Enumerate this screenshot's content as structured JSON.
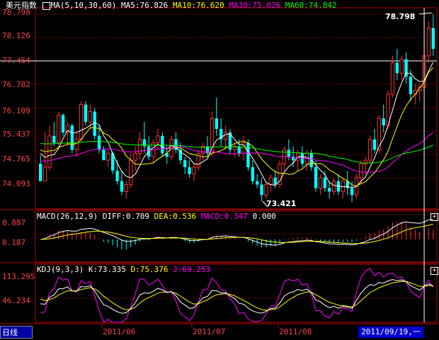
{
  "colors": {
    "up": "#ff3030",
    "down": "#00ffff",
    "ma5": "#ffffff",
    "ma10": "#ffff00",
    "ma30": "#ff00ff",
    "ma60": "#00ff00",
    "grid": "#800000",
    "axis": "#b00000"
  },
  "legend": {
    "name": "美元指数",
    "ma_params": "MA(5,10,30,60)",
    "ma5": "MA5:76.826",
    "ma10": "MA10:76.620",
    "ma30": "MA30:75.026",
    "ma60": "MA60:74.842"
  },
  "price_panel": {
    "y_ticks": [
      "78.798",
      "78.126",
      "77.454",
      "76.782",
      "76.109",
      "75.437",
      "74.765",
      "74.093"
    ],
    "high_label": "78.798",
    "low_label": "73.421"
  },
  "macd_panel": {
    "params": "MACD(26,12,9)",
    "diff": "DIFF:0.709",
    "dea": "DEA:0.536",
    "macd": "MACD:0.347",
    "zero": "0.000",
    "y_ticks": [
      "0.887",
      "0.187"
    ]
  },
  "kdj_panel": {
    "params": "KDJ(9,3,3)",
    "k": "K:73.335",
    "d": "D:75.376",
    "j": "J:69.253",
    "y_ticks": [
      "113.295",
      "46.234"
    ]
  },
  "x_axis": {
    "labels": [
      "2011/06",
      "2011/07",
      "2011/08"
    ],
    "current_date": "2011/09/19,一"
  },
  "tab": {
    "label": "日线"
  },
  "chart_data": {
    "type": "candlestick",
    "candles": [
      [
        74.5,
        74.75,
        74.0,
        74.0
      ],
      [
        74.0,
        75.4,
        74.2,
        74.4
      ],
      [
        74.4,
        75.6,
        74.3,
        75.3
      ],
      [
        75.3,
        75.7,
        75.0,
        75.1
      ],
      [
        75.1,
        76.0,
        74.9,
        75.9
      ],
      [
        75.9,
        75.95,
        75.3,
        75.4
      ],
      [
        75.4,
        75.7,
        75.0,
        75.6
      ],
      [
        75.6,
        75.65,
        74.8,
        74.9
      ],
      [
        74.9,
        75.4,
        74.7,
        75.2
      ],
      [
        75.2,
        76.3,
        75.1,
        76.2
      ],
      [
        76.2,
        76.3,
        75.6,
        75.7
      ],
      [
        75.7,
        76.2,
        75.5,
        76.0
      ],
      [
        76.0,
        76.1,
        75.2,
        75.3
      ],
      [
        75.3,
        75.6,
        74.8,
        74.9
      ],
      [
        74.9,
        75.0,
        74.6,
        74.6
      ],
      [
        74.6,
        74.9,
        74.4,
        74.8
      ],
      [
        74.8,
        74.85,
        74.2,
        74.3
      ],
      [
        74.3,
        74.6,
        73.9,
        74.0
      ],
      [
        74.0,
        74.3,
        73.6,
        73.7
      ],
      [
        73.7,
        74.0,
        73.5,
        73.9
      ],
      [
        73.9,
        74.8,
        73.8,
        74.6
      ],
      [
        74.6,
        75.0,
        74.3,
        74.8
      ],
      [
        74.8,
        75.4,
        74.6,
        75.2
      ],
      [
        75.2,
        75.7,
        74.8,
        75.0
      ],
      [
        75.0,
        75.3,
        74.6,
        74.7
      ],
      [
        74.7,
        75.2,
        74.5,
        75.1
      ],
      [
        75.1,
        75.5,
        74.9,
        75.3
      ],
      [
        75.3,
        75.4,
        74.7,
        74.8
      ],
      [
        74.8,
        75.0,
        74.5,
        74.7
      ],
      [
        74.7,
        75.3,
        74.6,
        75.2
      ],
      [
        75.2,
        75.4,
        74.8,
        74.9
      ],
      [
        74.9,
        75.1,
        74.5,
        74.6
      ],
      [
        74.6,
        74.7,
        74.2,
        74.4
      ],
      [
        74.4,
        74.6,
        74.1,
        74.2
      ],
      [
        74.2,
        74.5,
        74.0,
        74.4
      ],
      [
        74.4,
        74.9,
        74.3,
        74.8
      ],
      [
        74.8,
        75.1,
        74.6,
        75.0
      ],
      [
        75.0,
        75.3,
        74.7,
        74.8
      ],
      [
        74.8,
        76.0,
        74.7,
        75.8
      ],
      [
        75.8,
        76.4,
        75.3,
        75.5
      ],
      [
        75.5,
        75.8,
        75.0,
        75.2
      ],
      [
        75.2,
        75.6,
        74.9,
        75.4
      ],
      [
        75.4,
        75.5,
        74.8,
        74.9
      ],
      [
        74.9,
        75.1,
        74.7,
        75.0
      ],
      [
        75.0,
        75.2,
        74.7,
        74.8
      ],
      [
        74.8,
        75.3,
        74.6,
        75.1
      ],
      [
        75.1,
        75.2,
        74.3,
        74.4
      ],
      [
        74.4,
        74.6,
        73.9,
        74.0
      ],
      [
        74.0,
        74.2,
        73.8,
        73.9
      ],
      [
        73.9,
        74.1,
        73.421,
        73.6
      ],
      [
        73.6,
        74.0,
        73.5,
        73.9
      ],
      [
        73.9,
        74.2,
        73.7,
        74.1
      ],
      [
        74.1,
        74.3,
        73.8,
        73.9
      ],
      [
        73.9,
        74.6,
        73.8,
        74.5
      ],
      [
        74.5,
        75.0,
        74.3,
        74.9
      ],
      [
        74.9,
        75.2,
        74.6,
        74.7
      ],
      [
        74.7,
        75.0,
        74.4,
        74.6
      ],
      [
        74.6,
        74.9,
        74.3,
        74.8
      ],
      [
        74.8,
        75.0,
        74.4,
        74.5
      ],
      [
        74.5,
        74.9,
        74.3,
        74.8
      ],
      [
        74.8,
        74.9,
        74.3,
        74.4
      ],
      [
        74.4,
        74.6,
        73.7,
        73.8
      ],
      [
        73.8,
        74.2,
        73.6,
        74.1
      ],
      [
        74.1,
        74.3,
        73.7,
        73.8
      ],
      [
        73.8,
        74.0,
        73.5,
        73.7
      ],
      [
        73.7,
        74.1,
        73.6,
        74.0
      ],
      [
        74.0,
        74.2,
        73.6,
        73.7
      ],
      [
        73.7,
        74.1,
        73.5,
        74.0
      ],
      [
        74.0,
        74.3,
        73.6,
        73.8
      ],
      [
        73.8,
        74.0,
        73.4,
        73.6
      ],
      [
        73.6,
        74.2,
        73.5,
        74.1
      ],
      [
        74.1,
        74.6,
        73.9,
        74.5
      ],
      [
        74.5,
        74.7,
        74.2,
        74.6
      ],
      [
        74.6,
        75.3,
        74.5,
        75.2
      ],
      [
        75.2,
        75.5,
        74.8,
        74.9
      ],
      [
        74.9,
        75.9,
        74.8,
        75.8
      ],
      [
        75.8,
        76.2,
        75.4,
        75.6
      ],
      [
        75.6,
        76.6,
        75.5,
        76.5
      ],
      [
        76.5,
        77.6,
        76.4,
        77.4
      ],
      [
        77.4,
        77.8,
        76.9,
        77.1
      ],
      [
        77.1,
        77.6,
        76.9,
        77.5
      ],
      [
        77.5,
        77.7,
        76.8,
        77.0
      ],
      [
        77.0,
        77.2,
        76.3,
        76.5
      ],
      [
        76.5,
        76.8,
        76.2,
        76.6
      ],
      [
        76.6,
        76.8,
        76.3,
        76.7
      ],
      [
        76.7,
        77.7,
        76.6,
        77.6
      ],
      [
        77.6,
        78.6,
        77.4,
        78.4
      ],
      [
        78.4,
        78.798,
        77.6,
        77.8
      ]
    ],
    "ma_series": [
      {
        "name": "MA5",
        "color": "#ffffff"
      },
      {
        "name": "MA10",
        "color": "#ffff00"
      },
      {
        "name": "MA30",
        "color": "#ff00ff"
      },
      {
        "name": "MA60",
        "color": "#00ff00"
      }
    ],
    "macd": {
      "diff_last": 0.709,
      "dea_last": 0.536,
      "macd_last": 0.347
    },
    "kdj": {
      "k_last": 73.335,
      "d_last": 75.376,
      "j_last": 69.253
    },
    "price_range": [
      73.2,
      78.98
    ],
    "macd_range": [
      -0.8,
      1.0
    ],
    "kdj_range": [
      -10,
      125
    ]
  }
}
